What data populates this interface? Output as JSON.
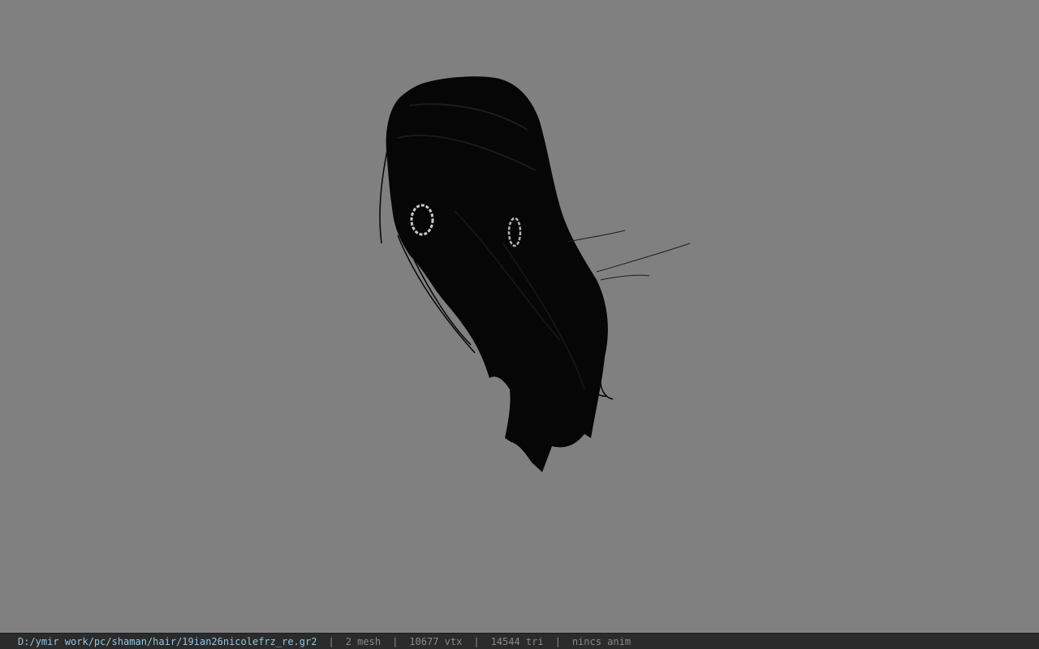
{
  "viewer": {
    "background_color": "#808080",
    "model_color": "#050505",
    "model_name_icon": "hair-mesh-render",
    "earring_color": "#c8c8c8"
  },
  "status_bar": {
    "file_path": "D:/ymir work/pc/shaman/hair/19ian26nicolefrz_re.gr2",
    "separator": "|",
    "mesh_count": "2 mesh",
    "vertex_count": "10677 vtx",
    "triangle_count": "14544 tri",
    "anim_info": "nincs anim",
    "background_color": "#2b2b2b",
    "path_color": "#8fc6e8",
    "text_color": "#8a8a8a"
  }
}
